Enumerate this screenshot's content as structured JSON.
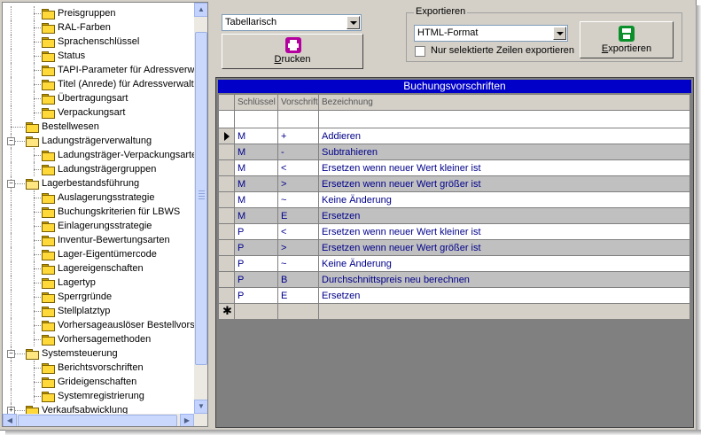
{
  "tree": {
    "items": [
      {
        "label": "Preisgruppen",
        "level": 2
      },
      {
        "label": "RAL-Farben",
        "level": 2
      },
      {
        "label": "Sprachenschlüssel",
        "level": 2
      },
      {
        "label": "Status",
        "level": 2
      },
      {
        "label": "TAPI-Parameter für Adressverwa",
        "level": 2
      },
      {
        "label": "Titel (Anrede) für Adressverwaltu",
        "level": 2
      },
      {
        "label": "Übertragungsart",
        "level": 2
      },
      {
        "label": "Verpackungsart",
        "level": 2
      },
      {
        "label": "Bestellwesen",
        "level": 1
      },
      {
        "label": "Ladungsträgerverwaltung",
        "level": 1,
        "expander": "−"
      },
      {
        "label": "Ladungsträger-Verpackungsarte",
        "level": 2
      },
      {
        "label": "Ladungsträgergruppen",
        "level": 2
      },
      {
        "label": "Lagerbestandsführung",
        "level": 1,
        "expander": "−"
      },
      {
        "label": "Auslagerungsstrategie",
        "level": 2
      },
      {
        "label": "Buchungskriterien für LBWS",
        "level": 2
      },
      {
        "label": "Einlagerungsstrategie",
        "level": 2
      },
      {
        "label": "Inventur-Bewertungsarten",
        "level": 2
      },
      {
        "label": "Lager-Eigentümercode",
        "level": 2
      },
      {
        "label": "Lagereigenschaften",
        "level": 2
      },
      {
        "label": "Lagertyp",
        "level": 2
      },
      {
        "label": "Sperrgründe",
        "level": 2
      },
      {
        "label": "Stellplatztyp",
        "level": 2
      },
      {
        "label": "Vorhersageauslöser Bestellvorsc",
        "level": 2
      },
      {
        "label": "Vorhersagemethoden",
        "level": 2
      },
      {
        "label": "Systemsteuerung",
        "level": 1,
        "expander": "−"
      },
      {
        "label": "Berichtsvorschriften",
        "level": 2
      },
      {
        "label": "Grideigenschaften",
        "level": 2
      },
      {
        "label": "Systemregistrierung",
        "level": 2
      },
      {
        "label": "Verkaufsabwicklung",
        "level": 1,
        "expander": "+"
      }
    ]
  },
  "toolbar": {
    "view_select": "Tabellarisch",
    "print_label": "Drucken",
    "export_group_title": "Exportieren",
    "format_select": "HTML-Format",
    "only_selected_label": "Nur selektierte Zeilen exportieren",
    "export_label": "Exportieren",
    "print_icon_color": "#b4009e",
    "export_icon_color": "#0a8f2a"
  },
  "grid": {
    "title": "Buchungsvorschriften",
    "columns": [
      "Schlüssel",
      "Vorschrift",
      "Bezeichnung"
    ],
    "rows": [
      [
        "M",
        "+",
        "Addieren"
      ],
      [
        "M",
        "-",
        "Subtrahieren"
      ],
      [
        "M",
        "<",
        "Ersetzen wenn neuer Wert kleiner ist"
      ],
      [
        "M",
        ">",
        "Ersetzen wenn neuer Wert größer ist"
      ],
      [
        "M",
        "~",
        "Keine Änderung"
      ],
      [
        "M",
        "E",
        "Ersetzen"
      ],
      [
        "P",
        "<",
        "Ersetzen wenn neuer Wert kleiner ist"
      ],
      [
        "P",
        ">",
        "Ersetzen wenn neuer Wert größer ist"
      ],
      [
        "P",
        "~",
        "Keine Änderung"
      ],
      [
        "P",
        "B",
        "Durchschnittspreis neu berechnen"
      ],
      [
        "P",
        "E",
        "Ersetzen"
      ]
    ],
    "new_row_marker": "✱"
  }
}
